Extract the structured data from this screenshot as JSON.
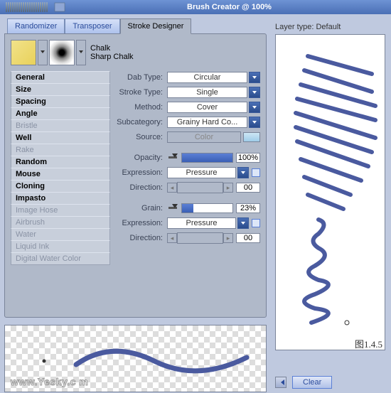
{
  "title": "Brush Creator @ 100%",
  "tabs": {
    "randomizer": "Randomizer",
    "transposer": "Transposer",
    "stroke": "Stroke Designer"
  },
  "brush": {
    "name": "Chalk",
    "variant": "Sharp Chalk"
  },
  "categories": [
    {
      "label": "General",
      "bold": true
    },
    {
      "label": "Size",
      "bold": true
    },
    {
      "label": "Spacing",
      "bold": true
    },
    {
      "label": "Angle",
      "bold": true
    },
    {
      "label": "Bristle",
      "dim": true
    },
    {
      "label": "Well",
      "bold": true
    },
    {
      "label": "Rake",
      "dim": true
    },
    {
      "label": "Random",
      "bold": true
    },
    {
      "label": "Mouse",
      "bold": true
    },
    {
      "label": "Cloning",
      "bold": true
    },
    {
      "label": "Impasto",
      "bold": true
    },
    {
      "label": "Image Hose",
      "dim": true
    },
    {
      "label": "Airbrush",
      "dim": true
    },
    {
      "label": "Water",
      "dim": true
    },
    {
      "label": "Liquid Ink",
      "dim": true
    },
    {
      "label": "Digital Water Color",
      "dim": true
    }
  ],
  "props": {
    "dab_type": {
      "label": "Dab Type:",
      "value": "Circular"
    },
    "stroke_type": {
      "label": "Stroke Type:",
      "value": "Single"
    },
    "method": {
      "label": "Method:",
      "value": "Cover"
    },
    "subcategory": {
      "label": "Subcategory:",
      "value": "Grainy Hard Co..."
    },
    "source": {
      "label": "Source:",
      "value": "Color"
    },
    "opacity": {
      "label": "Opacity:",
      "value": "100%",
      "fill": 100
    },
    "expression1": {
      "label": "Expression:",
      "value": "Pressure"
    },
    "direction1": {
      "label": "Direction:",
      "value": "00"
    },
    "grain": {
      "label": "Grain:",
      "value": "23%",
      "fill": 23
    },
    "expression2": {
      "label": "Expression:",
      "value": "Pressure"
    },
    "direction2": {
      "label": "Direction:",
      "value": "00"
    }
  },
  "right": {
    "layer_type": "Layer type: Default",
    "clear": "Clear",
    "fig": "图1.4.5"
  },
  "watermark": "www.Yesky.c   m"
}
